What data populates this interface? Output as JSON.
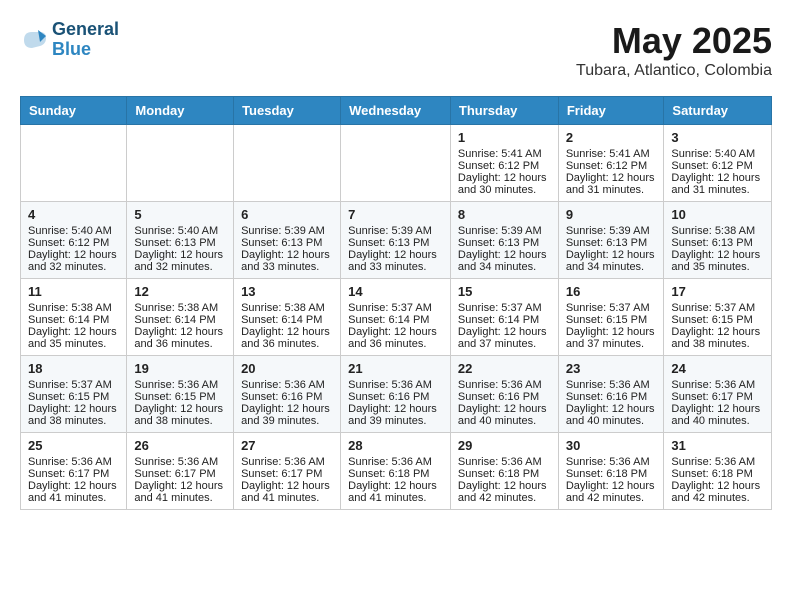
{
  "logo": {
    "line1": "General",
    "line2": "Blue"
  },
  "header": {
    "month": "May 2025",
    "location": "Tubara, Atlantico, Colombia"
  },
  "weekdays": [
    "Sunday",
    "Monday",
    "Tuesday",
    "Wednesday",
    "Thursday",
    "Friday",
    "Saturday"
  ],
  "weeks": [
    [
      {
        "day": "",
        "content": ""
      },
      {
        "day": "",
        "content": ""
      },
      {
        "day": "",
        "content": ""
      },
      {
        "day": "",
        "content": ""
      },
      {
        "day": "1",
        "content": "Sunrise: 5:41 AM\nSunset: 6:12 PM\nDaylight: 12 hours\nand 30 minutes."
      },
      {
        "day": "2",
        "content": "Sunrise: 5:41 AM\nSunset: 6:12 PM\nDaylight: 12 hours\nand 31 minutes."
      },
      {
        "day": "3",
        "content": "Sunrise: 5:40 AM\nSunset: 6:12 PM\nDaylight: 12 hours\nand 31 minutes."
      }
    ],
    [
      {
        "day": "4",
        "content": "Sunrise: 5:40 AM\nSunset: 6:12 PM\nDaylight: 12 hours\nand 32 minutes."
      },
      {
        "day": "5",
        "content": "Sunrise: 5:40 AM\nSunset: 6:13 PM\nDaylight: 12 hours\nand 32 minutes."
      },
      {
        "day": "6",
        "content": "Sunrise: 5:39 AM\nSunset: 6:13 PM\nDaylight: 12 hours\nand 33 minutes."
      },
      {
        "day": "7",
        "content": "Sunrise: 5:39 AM\nSunset: 6:13 PM\nDaylight: 12 hours\nand 33 minutes."
      },
      {
        "day": "8",
        "content": "Sunrise: 5:39 AM\nSunset: 6:13 PM\nDaylight: 12 hours\nand 34 minutes."
      },
      {
        "day": "9",
        "content": "Sunrise: 5:39 AM\nSunset: 6:13 PM\nDaylight: 12 hours\nand 34 minutes."
      },
      {
        "day": "10",
        "content": "Sunrise: 5:38 AM\nSunset: 6:13 PM\nDaylight: 12 hours\nand 35 minutes."
      }
    ],
    [
      {
        "day": "11",
        "content": "Sunrise: 5:38 AM\nSunset: 6:14 PM\nDaylight: 12 hours\nand 35 minutes."
      },
      {
        "day": "12",
        "content": "Sunrise: 5:38 AM\nSunset: 6:14 PM\nDaylight: 12 hours\nand 36 minutes."
      },
      {
        "day": "13",
        "content": "Sunrise: 5:38 AM\nSunset: 6:14 PM\nDaylight: 12 hours\nand 36 minutes."
      },
      {
        "day": "14",
        "content": "Sunrise: 5:37 AM\nSunset: 6:14 PM\nDaylight: 12 hours\nand 36 minutes."
      },
      {
        "day": "15",
        "content": "Sunrise: 5:37 AM\nSunset: 6:14 PM\nDaylight: 12 hours\nand 37 minutes."
      },
      {
        "day": "16",
        "content": "Sunrise: 5:37 AM\nSunset: 6:15 PM\nDaylight: 12 hours\nand 37 minutes."
      },
      {
        "day": "17",
        "content": "Sunrise: 5:37 AM\nSunset: 6:15 PM\nDaylight: 12 hours\nand 38 minutes."
      }
    ],
    [
      {
        "day": "18",
        "content": "Sunrise: 5:37 AM\nSunset: 6:15 PM\nDaylight: 12 hours\nand 38 minutes."
      },
      {
        "day": "19",
        "content": "Sunrise: 5:36 AM\nSunset: 6:15 PM\nDaylight: 12 hours\nand 38 minutes."
      },
      {
        "day": "20",
        "content": "Sunrise: 5:36 AM\nSunset: 6:16 PM\nDaylight: 12 hours\nand 39 minutes."
      },
      {
        "day": "21",
        "content": "Sunrise: 5:36 AM\nSunset: 6:16 PM\nDaylight: 12 hours\nand 39 minutes."
      },
      {
        "day": "22",
        "content": "Sunrise: 5:36 AM\nSunset: 6:16 PM\nDaylight: 12 hours\nand 40 minutes."
      },
      {
        "day": "23",
        "content": "Sunrise: 5:36 AM\nSunset: 6:16 PM\nDaylight: 12 hours\nand 40 minutes."
      },
      {
        "day": "24",
        "content": "Sunrise: 5:36 AM\nSunset: 6:17 PM\nDaylight: 12 hours\nand 40 minutes."
      }
    ],
    [
      {
        "day": "25",
        "content": "Sunrise: 5:36 AM\nSunset: 6:17 PM\nDaylight: 12 hours\nand 41 minutes."
      },
      {
        "day": "26",
        "content": "Sunrise: 5:36 AM\nSunset: 6:17 PM\nDaylight: 12 hours\nand 41 minutes."
      },
      {
        "day": "27",
        "content": "Sunrise: 5:36 AM\nSunset: 6:17 PM\nDaylight: 12 hours\nand 41 minutes."
      },
      {
        "day": "28",
        "content": "Sunrise: 5:36 AM\nSunset: 6:18 PM\nDaylight: 12 hours\nand 41 minutes."
      },
      {
        "day": "29",
        "content": "Sunrise: 5:36 AM\nSunset: 6:18 PM\nDaylight: 12 hours\nand 42 minutes."
      },
      {
        "day": "30",
        "content": "Sunrise: 5:36 AM\nSunset: 6:18 PM\nDaylight: 12 hours\nand 42 minutes."
      },
      {
        "day": "31",
        "content": "Sunrise: 5:36 AM\nSunset: 6:18 PM\nDaylight: 12 hours\nand 42 minutes."
      }
    ]
  ]
}
